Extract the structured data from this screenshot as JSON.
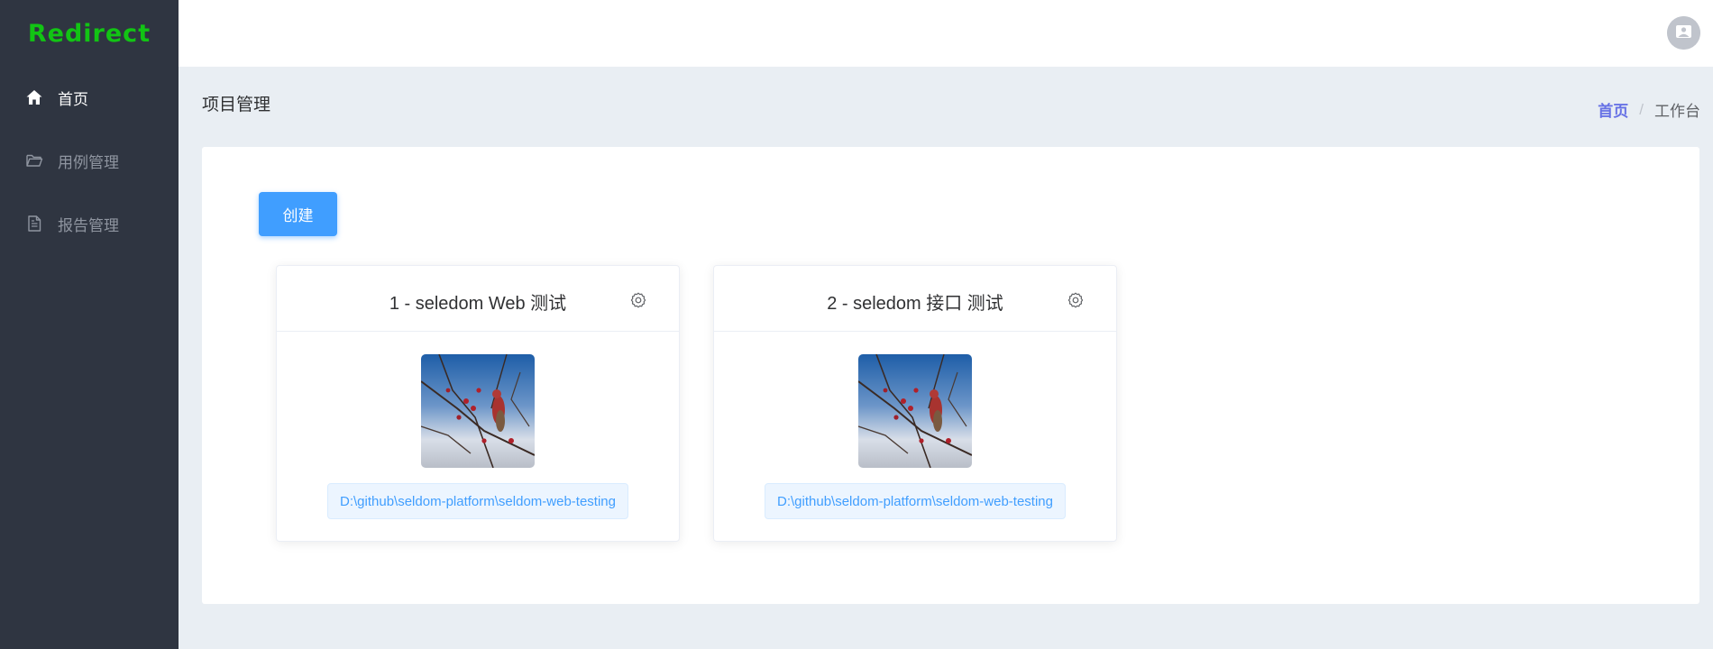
{
  "app": {
    "logo": "Redirect"
  },
  "sidebar": {
    "items": [
      {
        "label": "首页",
        "icon": "home-icon",
        "active": true
      },
      {
        "label": "用例管理",
        "icon": "folder-icon",
        "active": false
      },
      {
        "label": "报告管理",
        "icon": "document-icon",
        "active": false
      }
    ]
  },
  "header": {
    "avatar_icon": "user-avatar-icon"
  },
  "page": {
    "title": "项目管理",
    "breadcrumb": {
      "home": "首页",
      "separator": "/",
      "current": "工作台"
    }
  },
  "main": {
    "create_label": "创建",
    "projects": [
      {
        "title": "1 - seledom Web 测试",
        "path": "D:\\github\\seldom-platform\\seldom-web-testing",
        "settings_icon": "gear-icon"
      },
      {
        "title": "2 - seledom 接口 测试",
        "path": "D:\\github\\seldom-platform\\seldom-web-testing",
        "settings_icon": "gear-icon"
      }
    ]
  },
  "colors": {
    "sidebar_bg": "#2f3541",
    "logo": "#12c414",
    "primary": "#409eff",
    "breadcrumb_link": "#6772e5",
    "page_bg": "#e9eef3"
  }
}
